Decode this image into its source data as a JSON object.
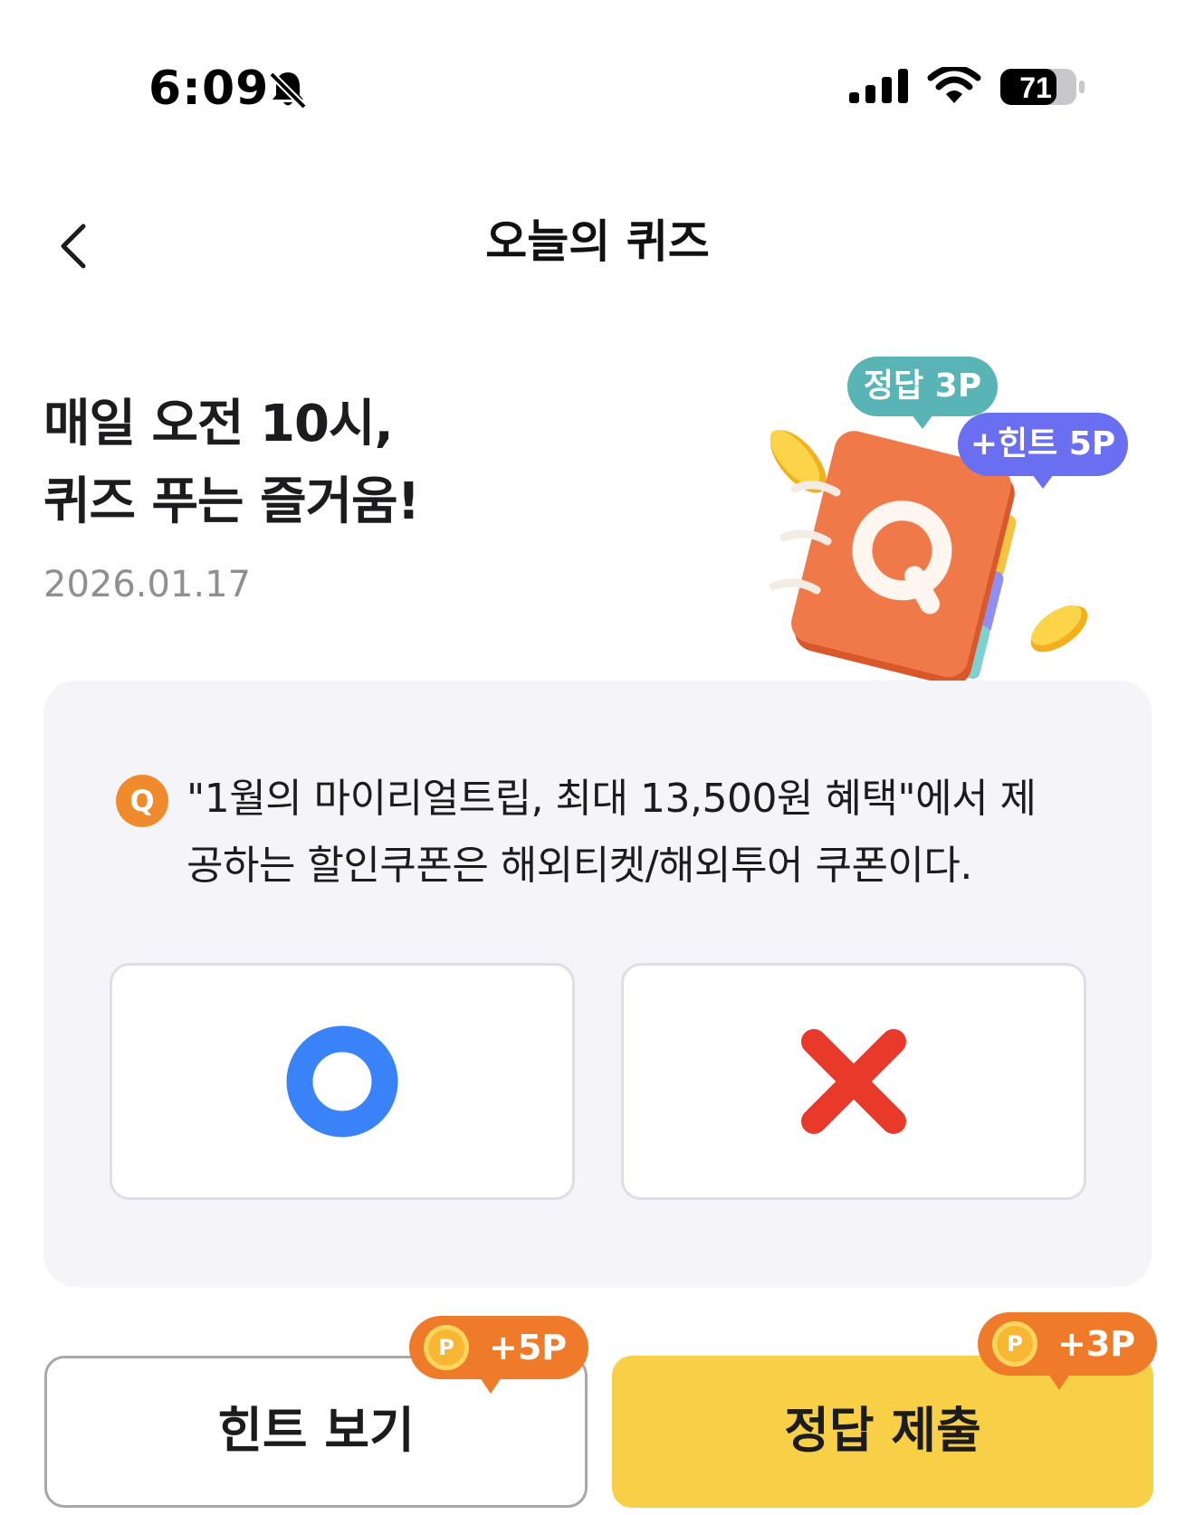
{
  "status_bar": {
    "time": "6:09",
    "battery": "71",
    "icons": [
      "bell-slash-icon",
      "signal-icon",
      "wifi-icon",
      "battery-icon"
    ]
  },
  "nav": {
    "back_icon": "chevron-left-icon",
    "title": "오늘의 퀴즈"
  },
  "hero": {
    "line1": "매일 오전 10시,",
    "line2": "퀴즈 푸는 즐거움!",
    "date": "2026.01.17",
    "bubble_answer": "정답 3P",
    "bubble_hint": "+힌트 5P",
    "illustration": "notebook-q-icon",
    "colors": {
      "answer_bubble": "#59b5b5",
      "hint_bubble": "#6a6ef0",
      "notebook": "#f0794a"
    }
  },
  "quiz": {
    "badge": "Q",
    "question_line1": "\"1월의 마이리얼트립, 최대 13,500원 혜택\"에서 제",
    "question_line2": "공하는 할인쿠폰은 해외티켓/해외투어 쿠폰이다.",
    "options": [
      {
        "icon": "circle-o-icon",
        "color": "#3a82f7"
      },
      {
        "icon": "cross-x-icon",
        "color": "#e9392b"
      }
    ]
  },
  "actions": {
    "hint_label": "힌트 보기",
    "hint_reward": "+5P",
    "submit_label": "정답 제출",
    "submit_reward": "+3P",
    "coin_letter": "P",
    "colors": {
      "submit": "#f7d047",
      "reward": "#ee7a2a"
    }
  }
}
